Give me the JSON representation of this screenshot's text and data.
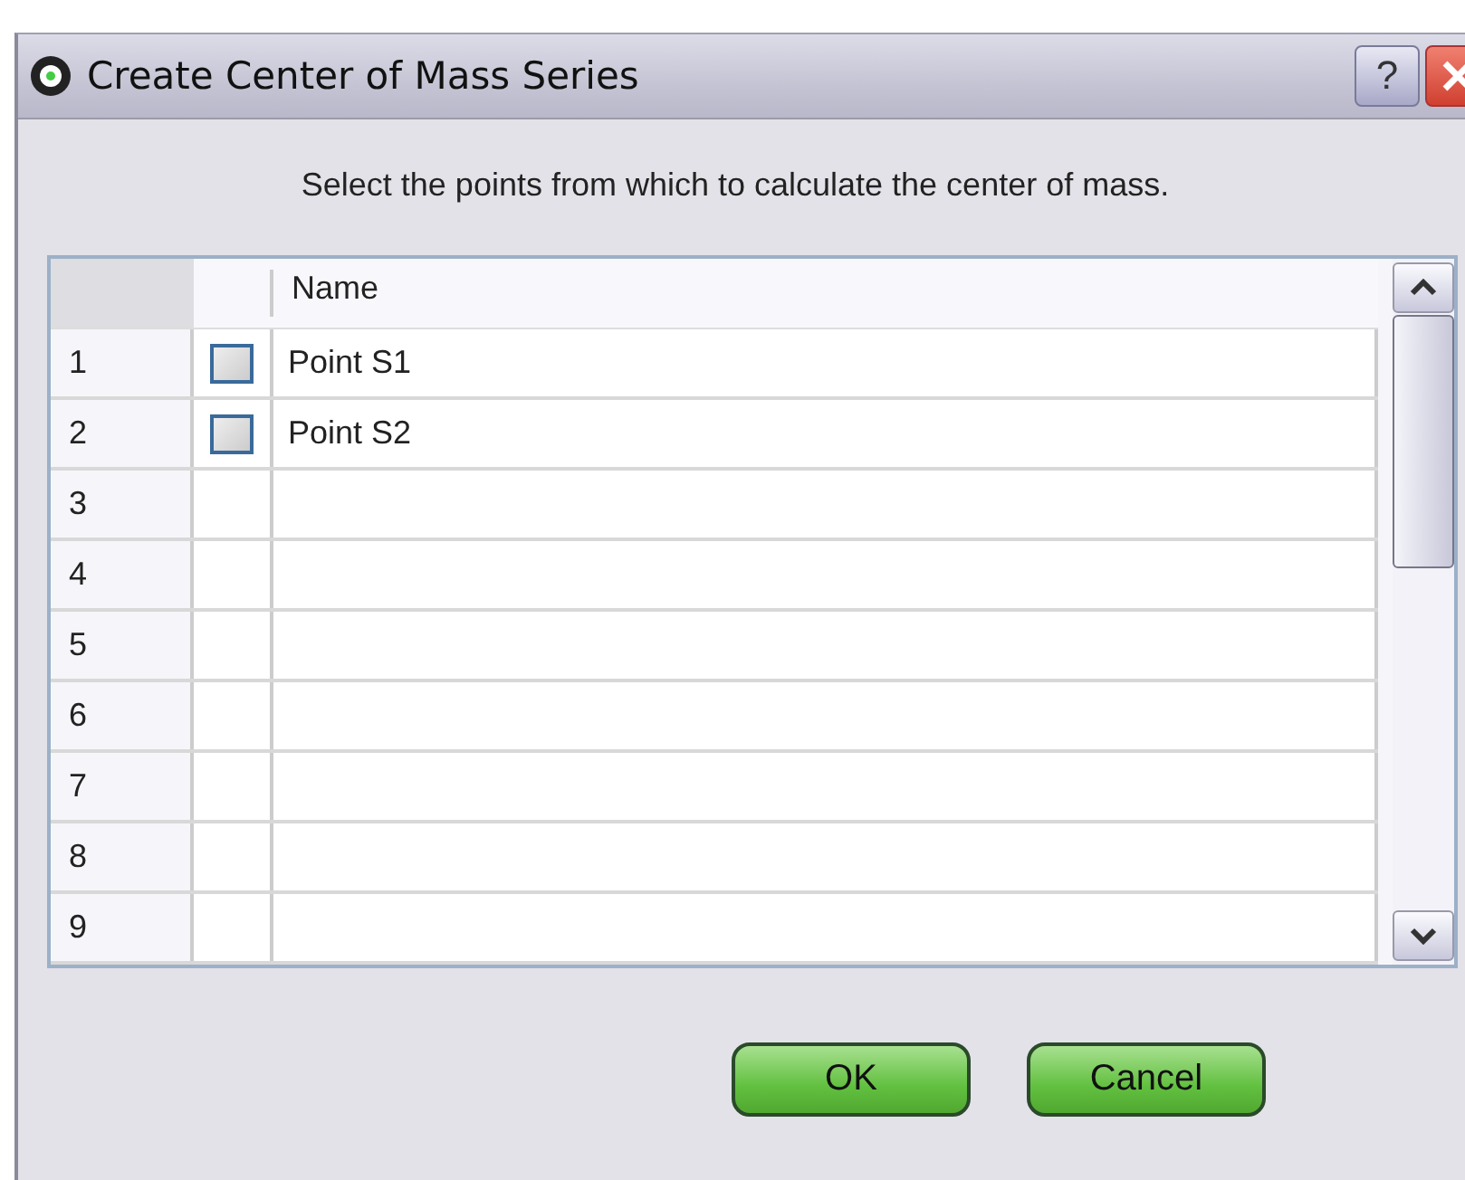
{
  "window": {
    "title": "Create Center of Mass Series",
    "help": "?"
  },
  "instruction": "Select the points from which to calculate the center of mass.",
  "table": {
    "columns": [
      "Name"
    ],
    "rows": [
      {
        "number": "1",
        "checked": false,
        "name": "Point S1"
      },
      {
        "number": "2",
        "checked": false,
        "name": "Point S2"
      },
      {
        "number": "3"
      },
      {
        "number": "4"
      },
      {
        "number": "5"
      },
      {
        "number": "6"
      },
      {
        "number": "7"
      },
      {
        "number": "8"
      },
      {
        "number": "9"
      }
    ]
  },
  "buttons": [
    "OK",
    "Cancel"
  ]
}
